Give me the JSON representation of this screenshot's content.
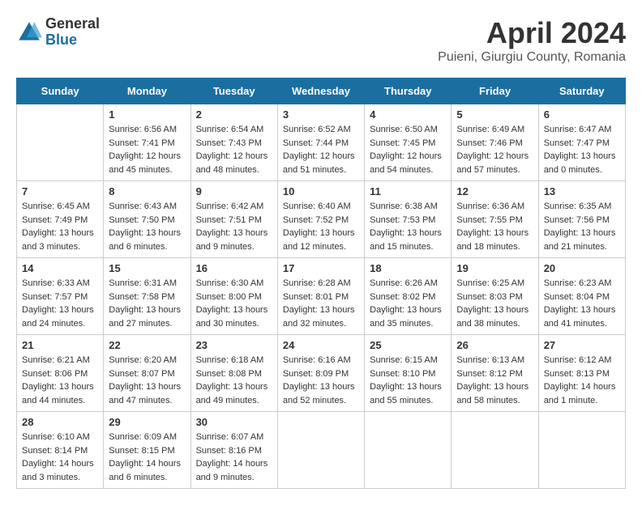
{
  "header": {
    "logo_general": "General",
    "logo_blue": "Blue",
    "title": "April 2024",
    "location": "Puieni, Giurgiu County, Romania"
  },
  "calendar": {
    "days_of_week": [
      "Sunday",
      "Monday",
      "Tuesday",
      "Wednesday",
      "Thursday",
      "Friday",
      "Saturday"
    ],
    "weeks": [
      [
        {
          "day": "",
          "info": ""
        },
        {
          "day": "1",
          "info": "Sunrise: 6:56 AM\nSunset: 7:41 PM\nDaylight: 12 hours\nand 45 minutes."
        },
        {
          "day": "2",
          "info": "Sunrise: 6:54 AM\nSunset: 7:43 PM\nDaylight: 12 hours\nand 48 minutes."
        },
        {
          "day": "3",
          "info": "Sunrise: 6:52 AM\nSunset: 7:44 PM\nDaylight: 12 hours\nand 51 minutes."
        },
        {
          "day": "4",
          "info": "Sunrise: 6:50 AM\nSunset: 7:45 PM\nDaylight: 12 hours\nand 54 minutes."
        },
        {
          "day": "5",
          "info": "Sunrise: 6:49 AM\nSunset: 7:46 PM\nDaylight: 12 hours\nand 57 minutes."
        },
        {
          "day": "6",
          "info": "Sunrise: 6:47 AM\nSunset: 7:47 PM\nDaylight: 13 hours\nand 0 minutes."
        }
      ],
      [
        {
          "day": "7",
          "info": "Sunrise: 6:45 AM\nSunset: 7:49 PM\nDaylight: 13 hours\nand 3 minutes."
        },
        {
          "day": "8",
          "info": "Sunrise: 6:43 AM\nSunset: 7:50 PM\nDaylight: 13 hours\nand 6 minutes."
        },
        {
          "day": "9",
          "info": "Sunrise: 6:42 AM\nSunset: 7:51 PM\nDaylight: 13 hours\nand 9 minutes."
        },
        {
          "day": "10",
          "info": "Sunrise: 6:40 AM\nSunset: 7:52 PM\nDaylight: 13 hours\nand 12 minutes."
        },
        {
          "day": "11",
          "info": "Sunrise: 6:38 AM\nSunset: 7:53 PM\nDaylight: 13 hours\nand 15 minutes."
        },
        {
          "day": "12",
          "info": "Sunrise: 6:36 AM\nSunset: 7:55 PM\nDaylight: 13 hours\nand 18 minutes."
        },
        {
          "day": "13",
          "info": "Sunrise: 6:35 AM\nSunset: 7:56 PM\nDaylight: 13 hours\nand 21 minutes."
        }
      ],
      [
        {
          "day": "14",
          "info": "Sunrise: 6:33 AM\nSunset: 7:57 PM\nDaylight: 13 hours\nand 24 minutes."
        },
        {
          "day": "15",
          "info": "Sunrise: 6:31 AM\nSunset: 7:58 PM\nDaylight: 13 hours\nand 27 minutes."
        },
        {
          "day": "16",
          "info": "Sunrise: 6:30 AM\nSunset: 8:00 PM\nDaylight: 13 hours\nand 30 minutes."
        },
        {
          "day": "17",
          "info": "Sunrise: 6:28 AM\nSunset: 8:01 PM\nDaylight: 13 hours\nand 32 minutes."
        },
        {
          "day": "18",
          "info": "Sunrise: 6:26 AM\nSunset: 8:02 PM\nDaylight: 13 hours\nand 35 minutes."
        },
        {
          "day": "19",
          "info": "Sunrise: 6:25 AM\nSunset: 8:03 PM\nDaylight: 13 hours\nand 38 minutes."
        },
        {
          "day": "20",
          "info": "Sunrise: 6:23 AM\nSunset: 8:04 PM\nDaylight: 13 hours\nand 41 minutes."
        }
      ],
      [
        {
          "day": "21",
          "info": "Sunrise: 6:21 AM\nSunset: 8:06 PM\nDaylight: 13 hours\nand 44 minutes."
        },
        {
          "day": "22",
          "info": "Sunrise: 6:20 AM\nSunset: 8:07 PM\nDaylight: 13 hours\nand 47 minutes."
        },
        {
          "day": "23",
          "info": "Sunrise: 6:18 AM\nSunset: 8:08 PM\nDaylight: 13 hours\nand 49 minutes."
        },
        {
          "day": "24",
          "info": "Sunrise: 6:16 AM\nSunset: 8:09 PM\nDaylight: 13 hours\nand 52 minutes."
        },
        {
          "day": "25",
          "info": "Sunrise: 6:15 AM\nSunset: 8:10 PM\nDaylight: 13 hours\nand 55 minutes."
        },
        {
          "day": "26",
          "info": "Sunrise: 6:13 AM\nSunset: 8:12 PM\nDaylight: 13 hours\nand 58 minutes."
        },
        {
          "day": "27",
          "info": "Sunrise: 6:12 AM\nSunset: 8:13 PM\nDaylight: 14 hours\nand 1 minute."
        }
      ],
      [
        {
          "day": "28",
          "info": "Sunrise: 6:10 AM\nSunset: 8:14 PM\nDaylight: 14 hours\nand 3 minutes."
        },
        {
          "day": "29",
          "info": "Sunrise: 6:09 AM\nSunset: 8:15 PM\nDaylight: 14 hours\nand 6 minutes."
        },
        {
          "day": "30",
          "info": "Sunrise: 6:07 AM\nSunset: 8:16 PM\nDaylight: 14 hours\nand 9 minutes."
        },
        {
          "day": "",
          "info": ""
        },
        {
          "day": "",
          "info": ""
        },
        {
          "day": "",
          "info": ""
        },
        {
          "day": "",
          "info": ""
        }
      ]
    ]
  }
}
